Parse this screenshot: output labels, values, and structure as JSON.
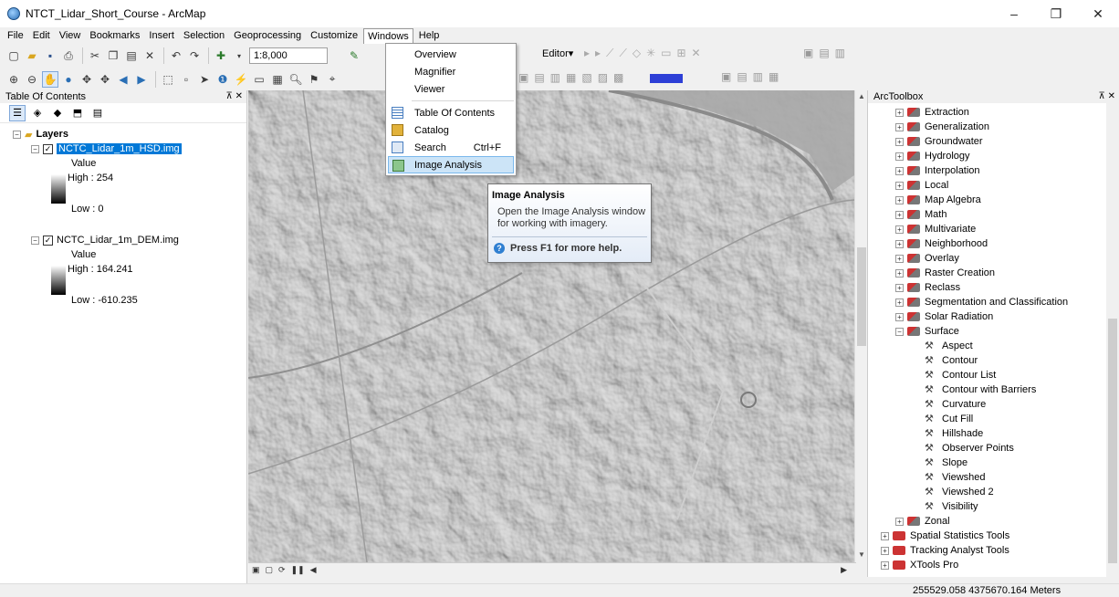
{
  "window": {
    "title": "NTCT_Lidar_Short_Course - ArcMap",
    "controls": [
      "–",
      "❐",
      "✕"
    ]
  },
  "menu": {
    "items": [
      "File",
      "Edit",
      "View",
      "Bookmarks",
      "Insert",
      "Selection",
      "Geoprocessing",
      "Customize",
      "Windows",
      "Help"
    ],
    "active": "Windows"
  },
  "toolbar": {
    "scale": "1:8,000",
    "editor_label": "Editor▾"
  },
  "toc": {
    "title": "Table Of Contents",
    "root": "Layers",
    "layers": [
      {
        "name": "NCTC_Lidar_1m_HSD.img",
        "value_label": "Value",
        "high": "High : 254",
        "low": "Low : 0"
      },
      {
        "name": "NCTC_Lidar_1m_DEM.img",
        "value_label": "Value",
        "high": "High : 164.241",
        "low": "Low : -610.235"
      }
    ]
  },
  "windows_menu": {
    "items": [
      {
        "label": "Overview",
        "icon": "none"
      },
      {
        "label": "Magnifier",
        "icon": "none"
      },
      {
        "label": "Viewer",
        "icon": "none"
      },
      {
        "label": "Table Of Contents",
        "icon": "table-of-contents-icon"
      },
      {
        "label": "Catalog",
        "icon": "catalog-icon"
      },
      {
        "label": "Search",
        "icon": "search-icon",
        "shortcut": "Ctrl+F"
      },
      {
        "label": "Image Analysis",
        "icon": "image-analysis-icon",
        "highlighted": true
      }
    ]
  },
  "tooltip": {
    "title": "Image Analysis",
    "body": "Open the Image Analysis window for working with imagery.",
    "help": "Press F1 for more help."
  },
  "arctoolbox": {
    "title": "ArcToolbox",
    "toolsets": [
      "Extraction",
      "Generalization",
      "Groundwater",
      "Hydrology",
      "Interpolation",
      "Local",
      "Map Algebra",
      "Math",
      "Multivariate",
      "Neighborhood",
      "Overlay",
      "Raster Creation",
      "Reclass",
      "Segmentation and Classification",
      "Solar Radiation"
    ],
    "expanded_toolset": "Surface",
    "surface_tools": [
      "Aspect",
      "Contour",
      "Contour List",
      "Contour with Barriers",
      "Curvature",
      "Cut Fill",
      "Hillshade",
      "Observer Points",
      "Slope",
      "Viewshed",
      "Viewshed 2",
      "Visibility"
    ],
    "after_toolset": "Zonal",
    "toolboxes": [
      "Spatial Statistics Tools",
      "Tracking Analyst Tools",
      "XTools Pro"
    ]
  },
  "status": {
    "coordinates": "255529.058  4375670.164 Meters"
  },
  "colors": {
    "selection": "#0078d7",
    "menu_hover": "#cce4f7",
    "map_base": "#b9b9b9"
  }
}
